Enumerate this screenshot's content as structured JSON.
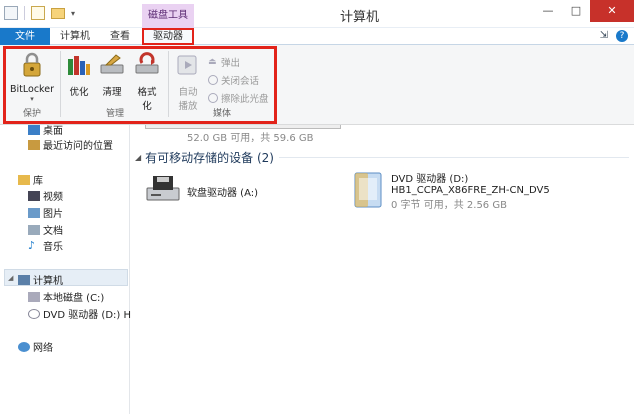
{
  "window": {
    "title": "计算机",
    "context_tab": "磁盘工具",
    "controls": {
      "minimize": "—",
      "maximize": "□",
      "close": "✕"
    }
  },
  "ribbon_tabs": {
    "file": "文件",
    "computer": "计算机",
    "view": "查看",
    "drive": "驱动器"
  },
  "ribbon": {
    "protect": {
      "label": "保护",
      "bitlocker": "BitLocker"
    },
    "manage": {
      "label": "管理",
      "optimize": "优化",
      "cleanup": "清理",
      "format_line1": "格式",
      "format_line2": "化"
    },
    "media": {
      "label": "媒体",
      "autoplay_line1": "自动",
      "autoplay_line2": "播放",
      "eject": "弹出",
      "close_session": "关闭会话",
      "erase_disc": "擦除此光盘"
    }
  },
  "nav": {
    "items": [
      {
        "label": "桌面"
      },
      {
        "label": "最近访问的位置"
      },
      {
        "label": "库"
      },
      {
        "label": "视频"
      },
      {
        "label": "图片"
      },
      {
        "label": "文档"
      },
      {
        "label": "音乐"
      },
      {
        "label": "计算机"
      },
      {
        "label": "本地磁盘 (C:)"
      },
      {
        "label": "DVD 驱动器 (D:) HB"
      },
      {
        "label": "网络"
      }
    ]
  },
  "content": {
    "top_disk_info": "52.0 GB 可用，共 59.6 GB",
    "group_title": "有可移动存储的设备 (2)",
    "floppy": {
      "name": "软盘驱动器 (A:)"
    },
    "dvd": {
      "name": "DVD 驱动器 (D:)",
      "label": "HB1_CCPA_X86FRE_ZH-CN_DV5",
      "space": "0 字节 可用，共 2.56 GB"
    }
  },
  "colors": {
    "accent": "#1979ca",
    "highlight": "#e2231a",
    "context_tab": "#ead2f2"
  }
}
